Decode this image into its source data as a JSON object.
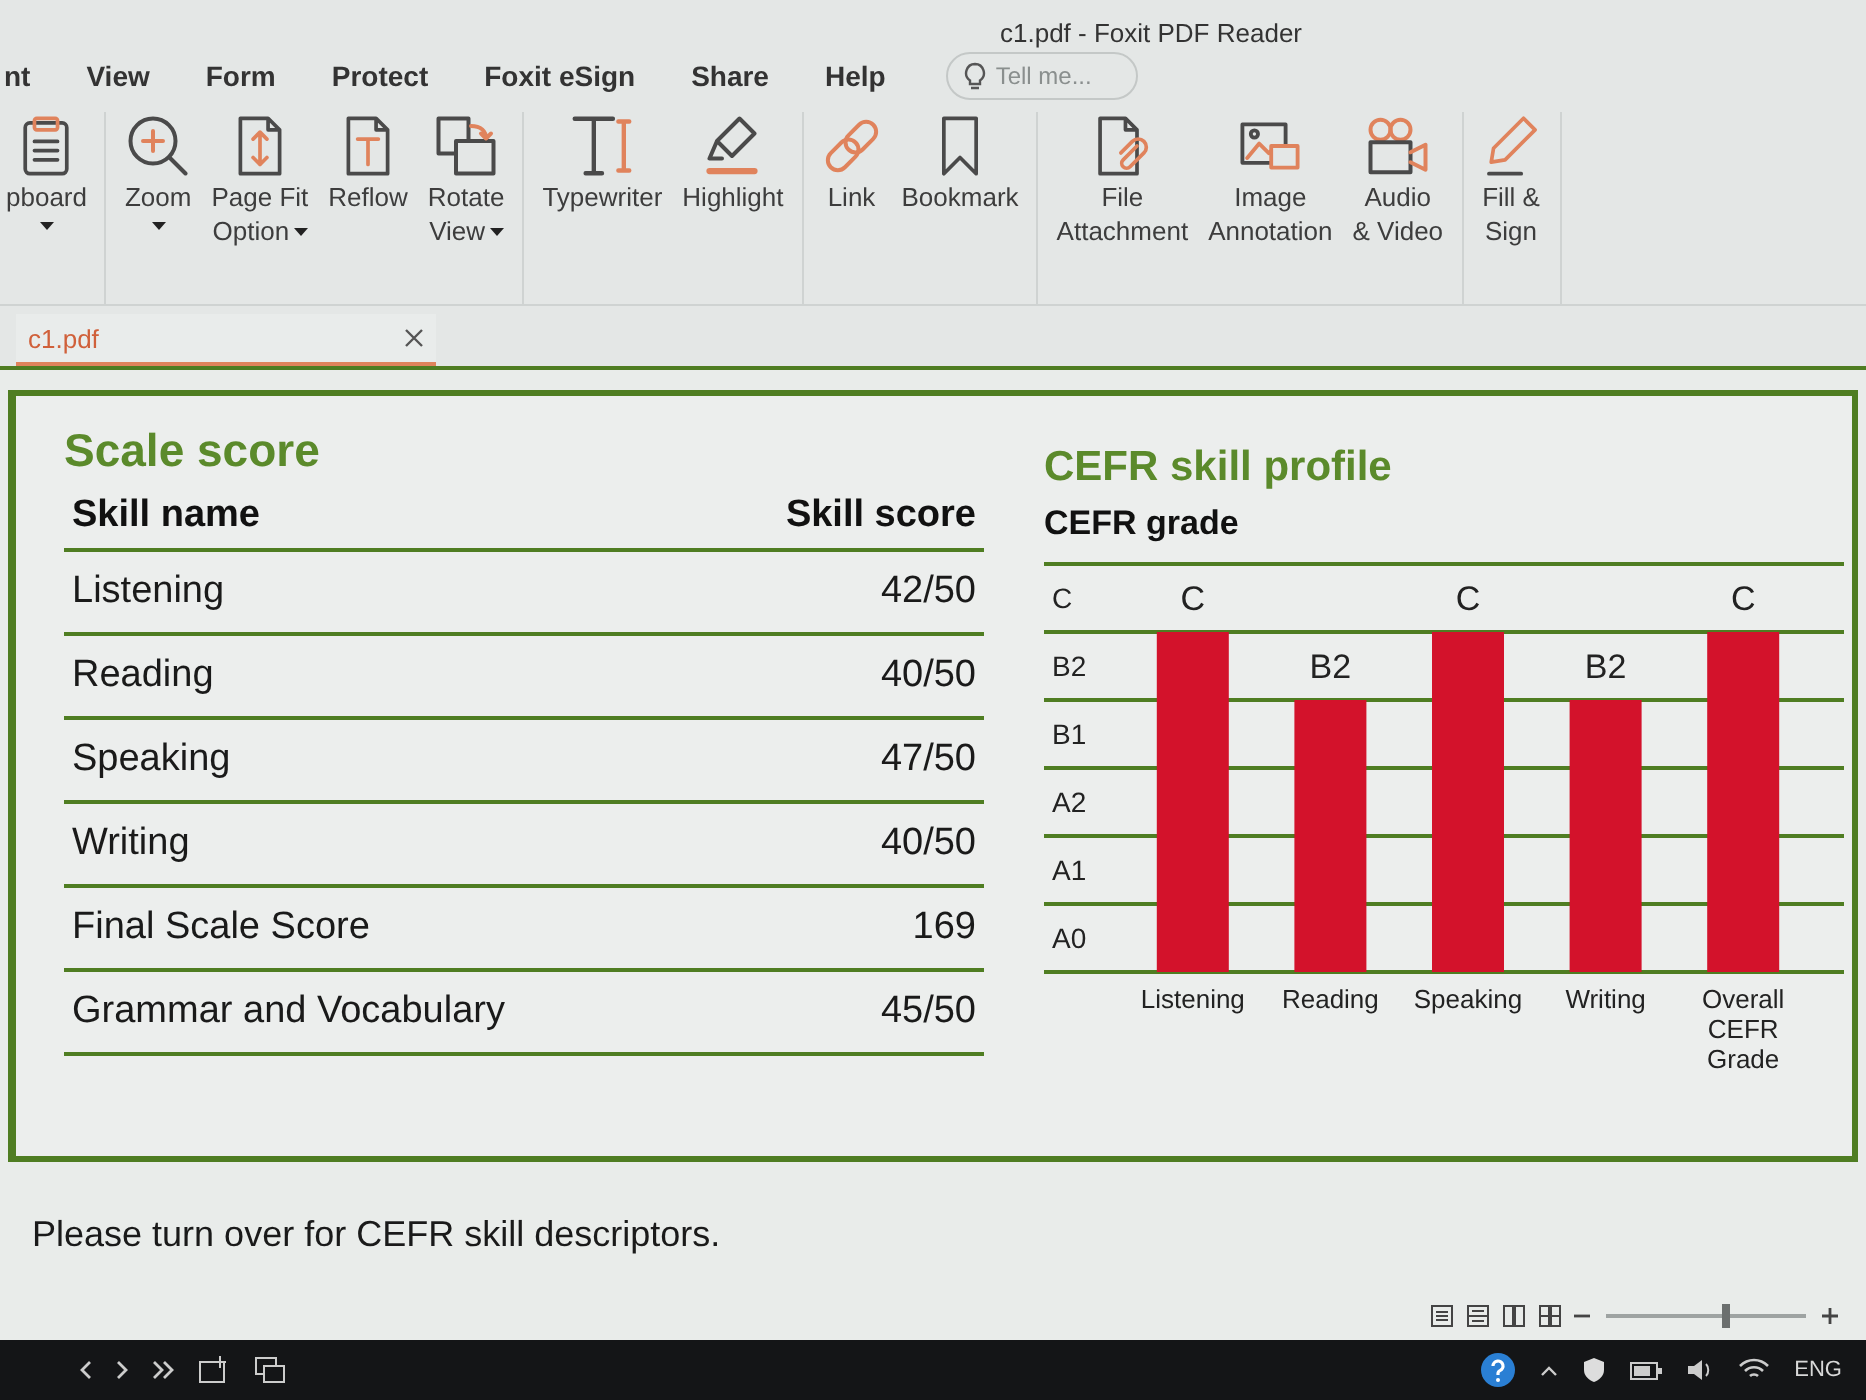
{
  "window": {
    "title": "c1.pdf - Foxit PDF Reader"
  },
  "menu_tabs": [
    "nt",
    "View",
    "Form",
    "Protect",
    "Foxit eSign",
    "Share",
    "Help"
  ],
  "search": {
    "placeholder": "Tell me..."
  },
  "ribbon": [
    {
      "buttons": [
        {
          "kind": "clipboard",
          "label": "pboard",
          "dropdown": true
        }
      ]
    },
    {
      "buttons": [
        {
          "kind": "zoom",
          "label": "Zoom",
          "dropdown": true
        },
        {
          "kind": "pagefit",
          "label": "Page Fit\nOption",
          "dropdown": true
        },
        {
          "kind": "reflow",
          "label": "Reflow",
          "dropdown": false
        },
        {
          "kind": "rotate",
          "label": "Rotate\nView",
          "dropdown": true
        }
      ]
    },
    {
      "buttons": [
        {
          "kind": "typewriter",
          "label": "Typewriter",
          "dropdown": false
        },
        {
          "kind": "highlight",
          "label": "Highlight",
          "dropdown": false
        }
      ]
    },
    {
      "buttons": [
        {
          "kind": "link",
          "label": "Link",
          "dropdown": false
        },
        {
          "kind": "bookmark",
          "label": "Bookmark",
          "dropdown": false
        }
      ]
    },
    {
      "buttons": [
        {
          "kind": "attachment",
          "label": "File\nAttachment",
          "dropdown": false
        },
        {
          "kind": "image",
          "label": "Image\nAnnotation",
          "dropdown": false
        },
        {
          "kind": "video",
          "label": "Audio\n& Video",
          "dropdown": false
        }
      ]
    },
    {
      "buttons": [
        {
          "kind": "sign",
          "label": "Fill &\nSign",
          "dropdown": false
        }
      ]
    }
  ],
  "document_tabs": [
    {
      "label": "c1.pdf",
      "selected": true
    }
  ],
  "scale_score": {
    "title": "Scale score",
    "columns": [
      "Skill name",
      "Skill score"
    ],
    "rows": [
      [
        "Listening",
        "42/50"
      ],
      [
        "Reading",
        "40/50"
      ],
      [
        "Speaking",
        "47/50"
      ],
      [
        "Writing",
        "40/50"
      ],
      [
        "Final Scale Score",
        "169"
      ],
      [
        "Grammar and Vocabulary",
        "45/50"
      ]
    ]
  },
  "cefr_profile": {
    "title": "CEFR skill profile",
    "axis_title": "CEFR grade",
    "grades": [
      "C",
      "B2",
      "B1",
      "A2",
      "A1",
      "A0"
    ],
    "skills": [
      {
        "name": "Listening",
        "grade": "C"
      },
      {
        "name": "Reading",
        "grade": "B2"
      },
      {
        "name": "Speaking",
        "grade": "C"
      },
      {
        "name": "Writing",
        "grade": "B2"
      },
      {
        "name": "Overall CEFR Grade",
        "grade": "C"
      }
    ]
  },
  "footer_note": "Please turn over for CEFR skill descriptors.",
  "status_bar": {
    "zoom": {
      "level": 0.6
    }
  },
  "taskbar": {
    "language": "ENG"
  }
}
